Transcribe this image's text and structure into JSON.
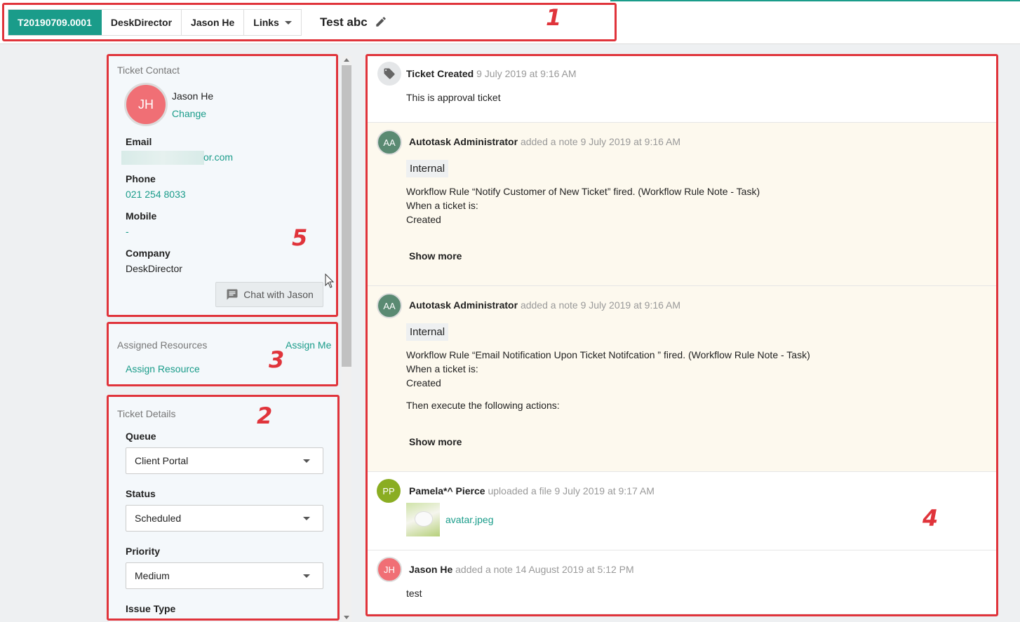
{
  "header": {
    "breadcrumbs": [
      {
        "label": "T20190709.0001",
        "active": true
      },
      {
        "label": "DeskDirector"
      },
      {
        "label": "Jason He"
      },
      {
        "label": "Links",
        "dropdown": true
      }
    ],
    "ticket_title": "Test abc"
  },
  "annotations": [
    "1",
    "2",
    "3",
    "4",
    "5"
  ],
  "contact": {
    "header": "Ticket Contact",
    "avatar_initials": "JH",
    "name": "Jason He",
    "change_label": "Change",
    "email_label": "Email",
    "email_value": "or.com",
    "phone_label": "Phone",
    "phone_value": "021 254 8033",
    "mobile_label": "Mobile",
    "mobile_value": "-",
    "company_label": "Company",
    "company_value": "DeskDirector",
    "chat_button": "Chat with Jason"
  },
  "resources": {
    "header": "Assigned Resources",
    "assign_me": "Assign Me",
    "assign_resource": "Assign Resource"
  },
  "details": {
    "header": "Ticket Details",
    "queue_label": "Queue",
    "queue_value": "Client Portal",
    "status_label": "Status",
    "status_value": "Scheduled",
    "priority_label": "Priority",
    "priority_value": "Medium",
    "issue_type_label": "Issue Type"
  },
  "feed": {
    "created": {
      "title": "Ticket Created",
      "time": "9 July 2019 at 9:16 AM",
      "text": "This is approval ticket"
    },
    "note1": {
      "initials": "AA",
      "author": "Autotask Administrator",
      "action": "added a note",
      "time": "9 July 2019 at 9:16 AM",
      "badge": "Internal",
      "lines": [
        "Workflow Rule “Notify Customer of New Ticket” fired. (Workflow Rule Note - Task)",
        "When a ticket is:",
        "Created"
      ],
      "show_more": "Show more"
    },
    "note2": {
      "initials": "AA",
      "author": "Autotask Administrator",
      "action": "added a note",
      "time": "9 July 2019 at 9:16 AM",
      "badge": "Internal",
      "lines": [
        "Workflow Rule “Email Notification Upon Ticket Notifcation ” fired. (Workflow Rule Note - Task)",
        "When a ticket is:",
        "Created"
      ],
      "extra_line": "Then execute the following actions:",
      "show_more": "Show more"
    },
    "upload": {
      "initials": "PP",
      "author": "Pamela*^ Pierce",
      "action": "uploaded a file",
      "time": "9 July 2019 at 9:17 AM",
      "file_name": "avatar.jpeg"
    },
    "note3": {
      "initials": "JH",
      "author": "Jason He",
      "action": "added a note",
      "time": "14 August 2019 at 5:12 PM",
      "text": "test"
    }
  },
  "colors": {
    "accent": "#1a9c8a",
    "annotation": "#e0343b",
    "avatar_aa": "#5a8a72",
    "avatar_pp": "#8aad22",
    "avatar_jh": "#f06f75"
  }
}
